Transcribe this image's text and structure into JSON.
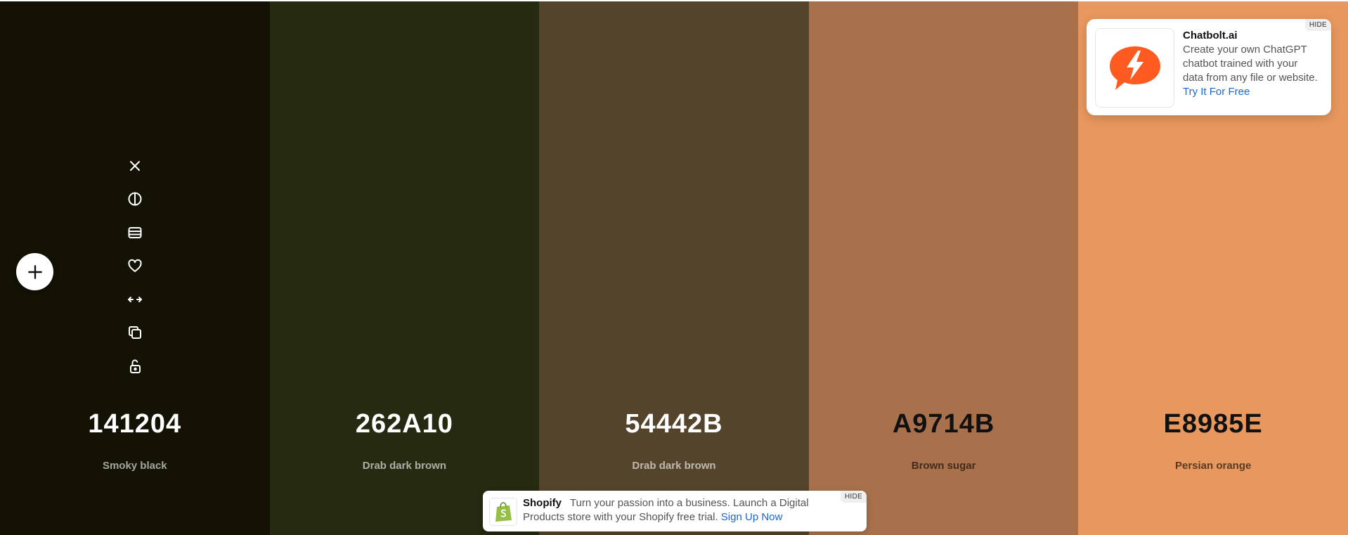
{
  "palette": {
    "swatches": [
      {
        "hex": "141204",
        "name": "Smoky black",
        "bg": "#141204",
        "text_theme": "light"
      },
      {
        "hex": "262A10",
        "name": "Drab dark brown",
        "bg": "#262A10",
        "text_theme": "light"
      },
      {
        "hex": "54442B",
        "name": "Drab dark brown",
        "bg": "#54442B",
        "text_theme": "light"
      },
      {
        "hex": "A9714B",
        "name": "Brown sugar",
        "bg": "#A9714B",
        "text_theme": "dark"
      },
      {
        "hex": "E8985E",
        "name": "Persian orange",
        "bg": "#E8985E",
        "text_theme": "dark"
      }
    ]
  },
  "tools": [
    {
      "icon": "close-icon"
    },
    {
      "icon": "contrast-icon"
    },
    {
      "icon": "shades-icon"
    },
    {
      "icon": "heart-icon"
    },
    {
      "icon": "drag-arrows-icon"
    },
    {
      "icon": "copy-icon"
    },
    {
      "icon": "unlock-icon"
    }
  ],
  "add_button": {
    "icon": "plus-icon"
  },
  "ad": {
    "title": "Chatbolt.ai",
    "body": "Create your own ChatGPT chatbot trained with your data from any file or website.",
    "link": "Try It For Free",
    "hide_label": "HIDE",
    "logo_color": "#FF5A1F"
  },
  "banner": {
    "title": "Shopify",
    "body": "Turn your passion into a business. Launch a Digital Products store with your Shopify free trial.",
    "link": "Sign Up Now",
    "hide_label": "HIDE",
    "logo_color": "#95BF47"
  }
}
